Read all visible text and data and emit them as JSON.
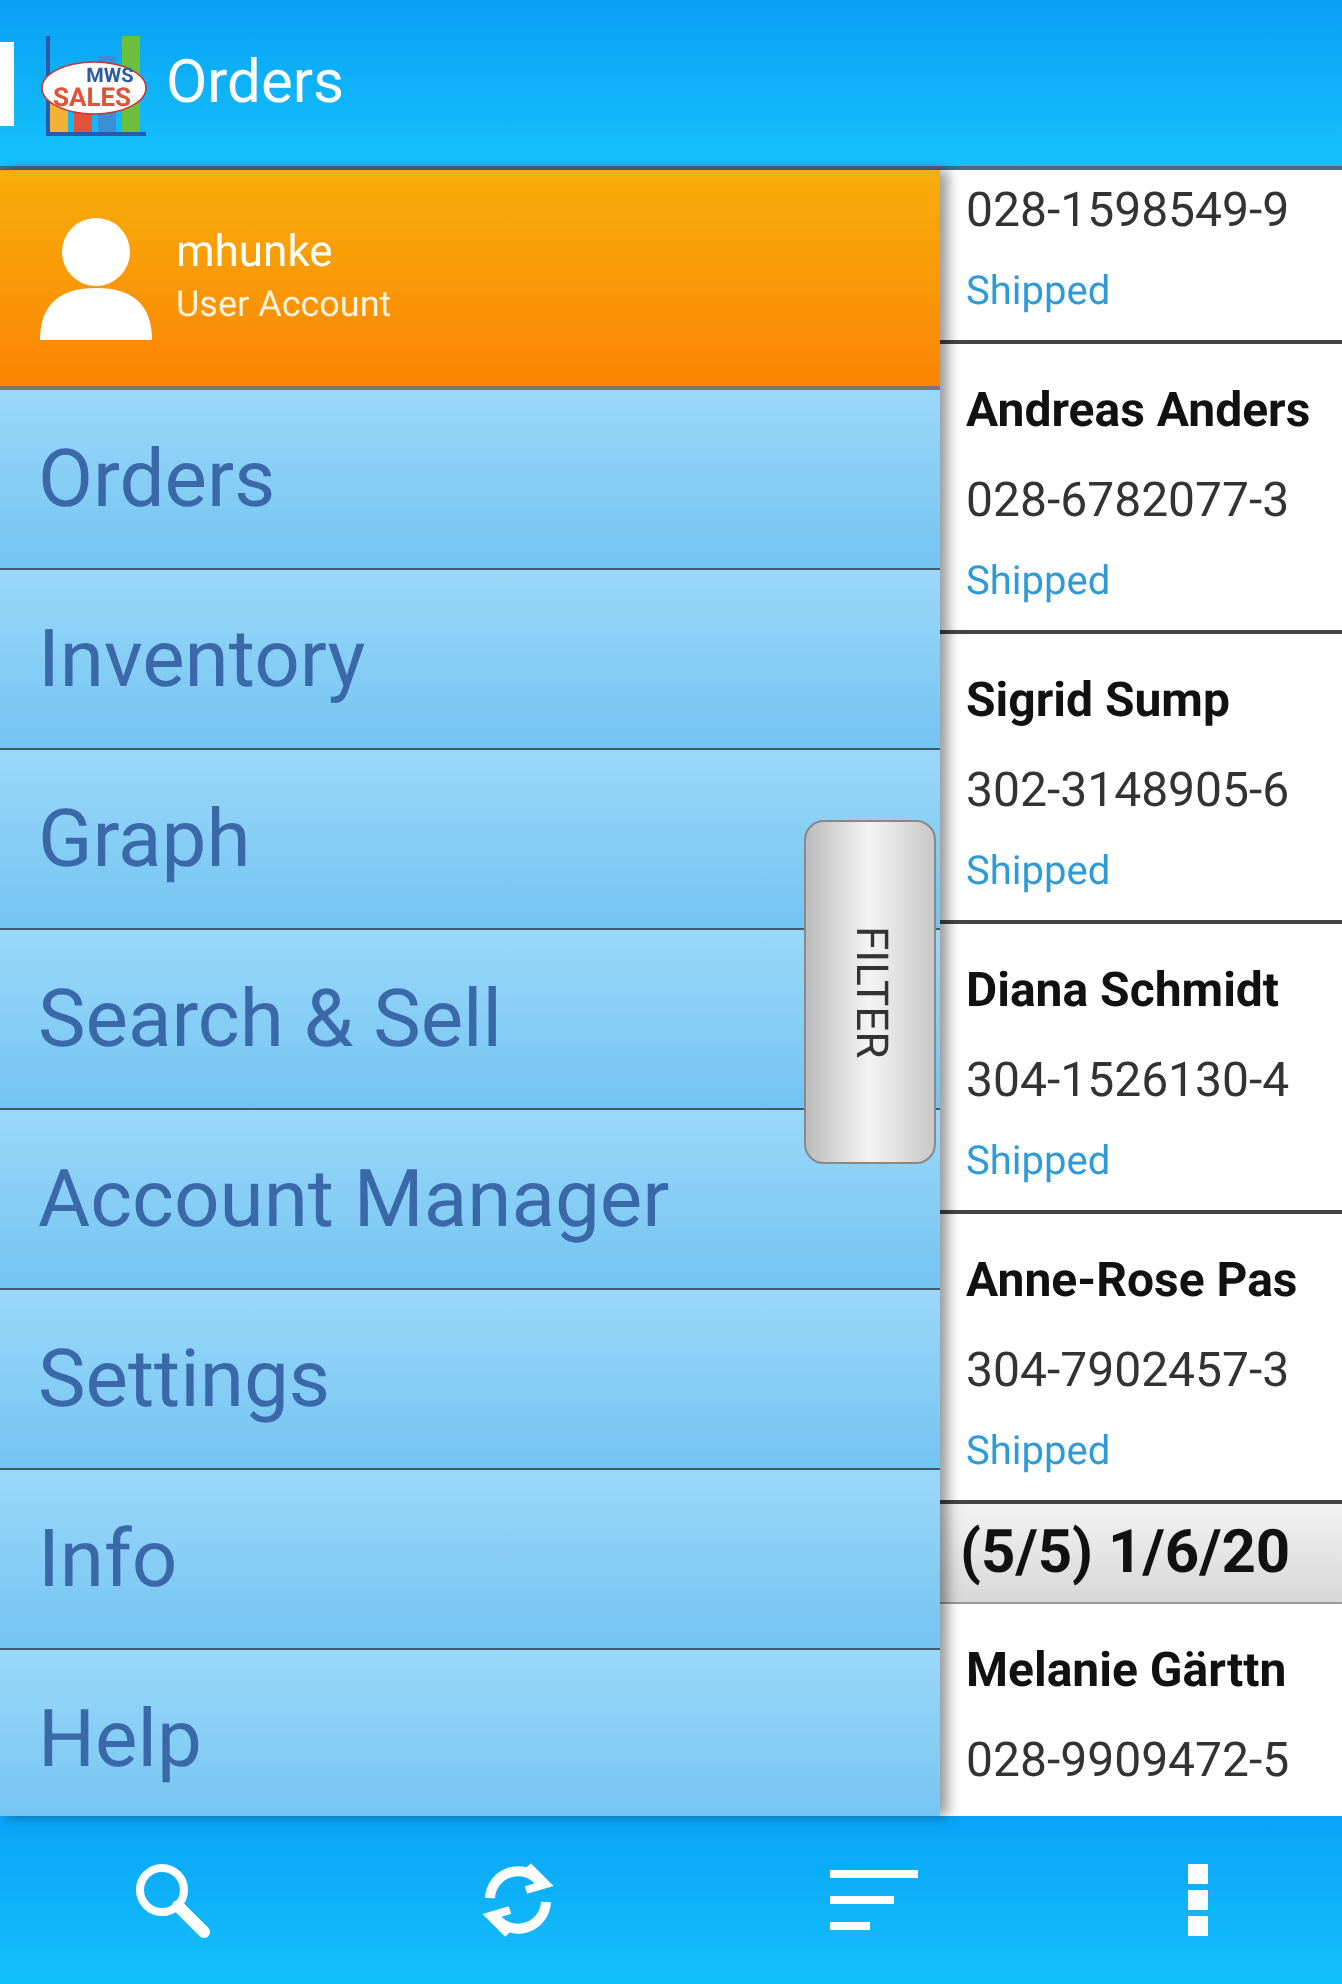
{
  "app_bar": {
    "logo_text": [
      "MWS",
      "SALES"
    ],
    "title": "Orders"
  },
  "account": {
    "name": "mhunke",
    "subtitle": "User Account"
  },
  "drawer": {
    "items": [
      {
        "label": "Orders"
      },
      {
        "label": "Inventory"
      },
      {
        "label": "Graph"
      },
      {
        "label": "Search & Sell"
      },
      {
        "label": "Account Manager"
      },
      {
        "label": "Settings"
      },
      {
        "label": "Info"
      },
      {
        "label": "Help"
      }
    ]
  },
  "filter_tab": "FILTER",
  "orders": [
    {
      "kind": "order",
      "number": "028-1598549-9",
      "status": "Shipped"
    },
    {
      "kind": "order",
      "name": "Andreas Anders",
      "number": "028-6782077-3",
      "status": "Shipped"
    },
    {
      "kind": "order",
      "name": "Sigrid Sump",
      "number": "302-3148905-6",
      "status": "Shipped"
    },
    {
      "kind": "order",
      "name": "Diana Schmidt",
      "number": "304-1526130-4",
      "status": "Shipped"
    },
    {
      "kind": "order",
      "name": "Anne-Rose Pas",
      "number": "304-7902457-3",
      "status": "Shipped"
    },
    {
      "kind": "header",
      "label": "(5/5) 1/6/20"
    },
    {
      "kind": "order",
      "name": "Melanie Gärttn",
      "number": "028-9909472-5"
    }
  ]
}
